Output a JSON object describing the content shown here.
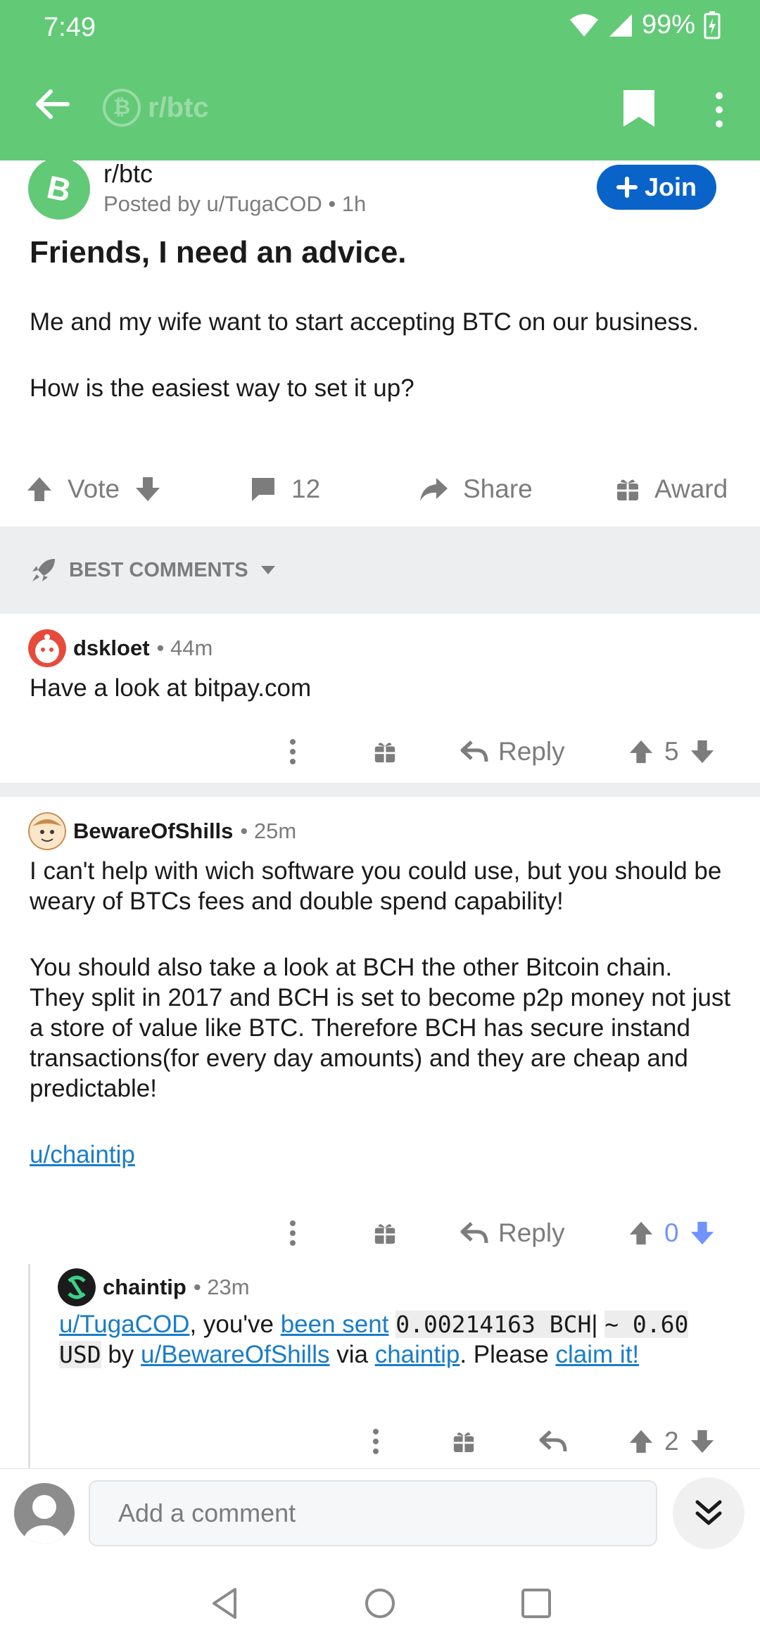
{
  "status_bar": {
    "time": "7:49",
    "battery": "99%"
  },
  "topbar": {
    "subreddit": "r/btc"
  },
  "post": {
    "subreddit": "r/btc",
    "posted_by": "Posted by u/TugaCOD • 1h",
    "join_label": "Join",
    "title": "Friends, I need an advice.",
    "body": [
      "Me and my wife want to start accepting BTC on our business.",
      "How is the easiest way to set it up?"
    ],
    "actions": {
      "vote_label": "Vote",
      "comments_count": "12",
      "share_label": "Share",
      "award_label": "Award"
    }
  },
  "sort": {
    "label": "BEST COMMENTS"
  },
  "comments": [
    {
      "user": "dskloet",
      "time": "• 44m",
      "body": [
        "Have a look at bitpay.com"
      ],
      "reply_label": "Reply",
      "score": "5"
    },
    {
      "user": "BewareOfShills",
      "time": "• 25m",
      "body": [
        "I can't help with wich software you could use, but you should be weary of BTCs fees and double spend capability!",
        "You should also take a look at BCH the other Bitcoin chain. They split in 2017 and BCH is set to become p2p money not just a store of value like BTC. Therefore BCH has secure instand transactions(for every day amounts) and they are cheap and predictable!"
      ],
      "link": "u/chaintip",
      "reply_label": "Reply",
      "score": "0"
    },
    {
      "user": "chaintip",
      "time": "• 23m",
      "tip": {
        "user_link": "u/TugaCOD",
        "text1": ", you've ",
        "been_sent": "been sent",
        "amount": "0.00214163 BCH",
        "sep": "|",
        "approx": "~ 0.60 USD",
        "text2": " by ",
        "sender_link": "u/BewareOfShills",
        "text3": " via ",
        "chaintip_link": "chaintip",
        "text4": ". Please ",
        "claim_link": "claim it!"
      },
      "score": "2"
    }
  ],
  "composer": {
    "placeholder": "Add a comment"
  },
  "colors": {
    "header_green": "#62c977",
    "join_blue": "#0a63c9",
    "link_blue": "#1a7dc7",
    "downvote_blue": "#7193ff"
  }
}
